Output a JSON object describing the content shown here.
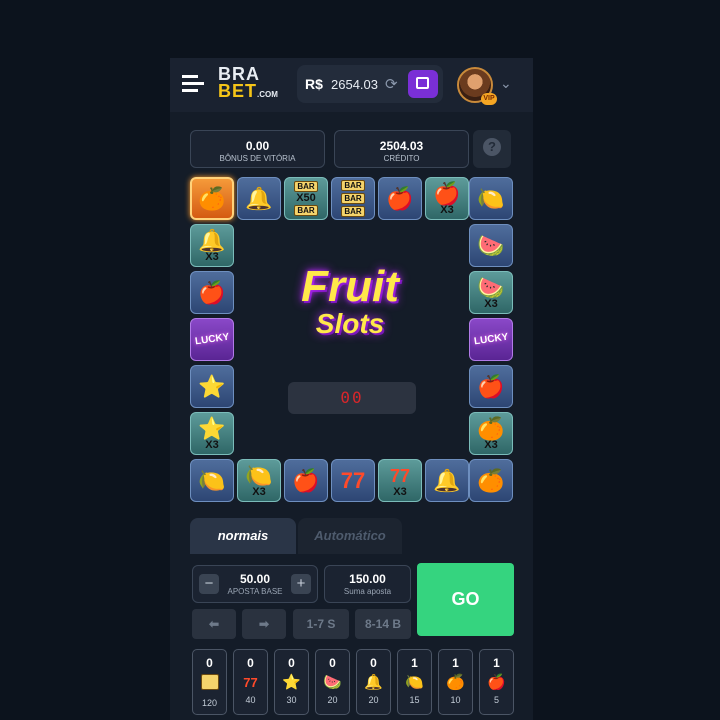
{
  "header": {
    "logo_line1": "BRA",
    "logo_line2": "BET",
    "logo_suffix": ".COM",
    "currency": "R$",
    "balance": "2654.03"
  },
  "stats": {
    "bonus_value": "0.00",
    "bonus_label": "BÔNUS DE VITÓRIA",
    "credit_value": "2504.03",
    "credit_label": "CRÉDITO",
    "help": "?"
  },
  "board": {
    "title_line1": "Fruit",
    "title_line2": "Slots",
    "counter": "00",
    "mult_x3": "X3",
    "x50": "X50",
    "bar": "BAR",
    "lucky": "LUCKY"
  },
  "tabs": {
    "normal": "normais",
    "auto": "Automático"
  },
  "controls": {
    "minus": "−",
    "plus": "+",
    "base_bet_value": "50.00",
    "base_bet_label": "APOSTA BASE",
    "sum_bet_value": "150.00",
    "sum_bet_label": "Suma aposta",
    "go": "GO",
    "prev": "⬅",
    "next": "➡",
    "range1": "1-7 S",
    "range2": "8-14 B"
  },
  "paytable": [
    {
      "count": "0",
      "icon": "bar-icon",
      "mult": "120"
    },
    {
      "count": "0",
      "icon": "seven-icon",
      "mult": "40"
    },
    {
      "count": "0",
      "icon": "star-icon",
      "mult": "30"
    },
    {
      "count": "0",
      "icon": "watermelon-icon",
      "mult": "20"
    },
    {
      "count": "0",
      "icon": "bell-icon",
      "mult": "20"
    },
    {
      "count": "1",
      "icon": "lemon-icon",
      "mult": "15"
    },
    {
      "count": "1",
      "icon": "orange-icon",
      "mult": "10"
    },
    {
      "count": "1",
      "icon": "apple-icon",
      "mult": "5"
    }
  ],
  "colors": {
    "go_button": "#35d47f",
    "accent_purple": "#7a2fd6",
    "counter_red": "#d8262a",
    "title_yellow": "#ffe94a"
  }
}
